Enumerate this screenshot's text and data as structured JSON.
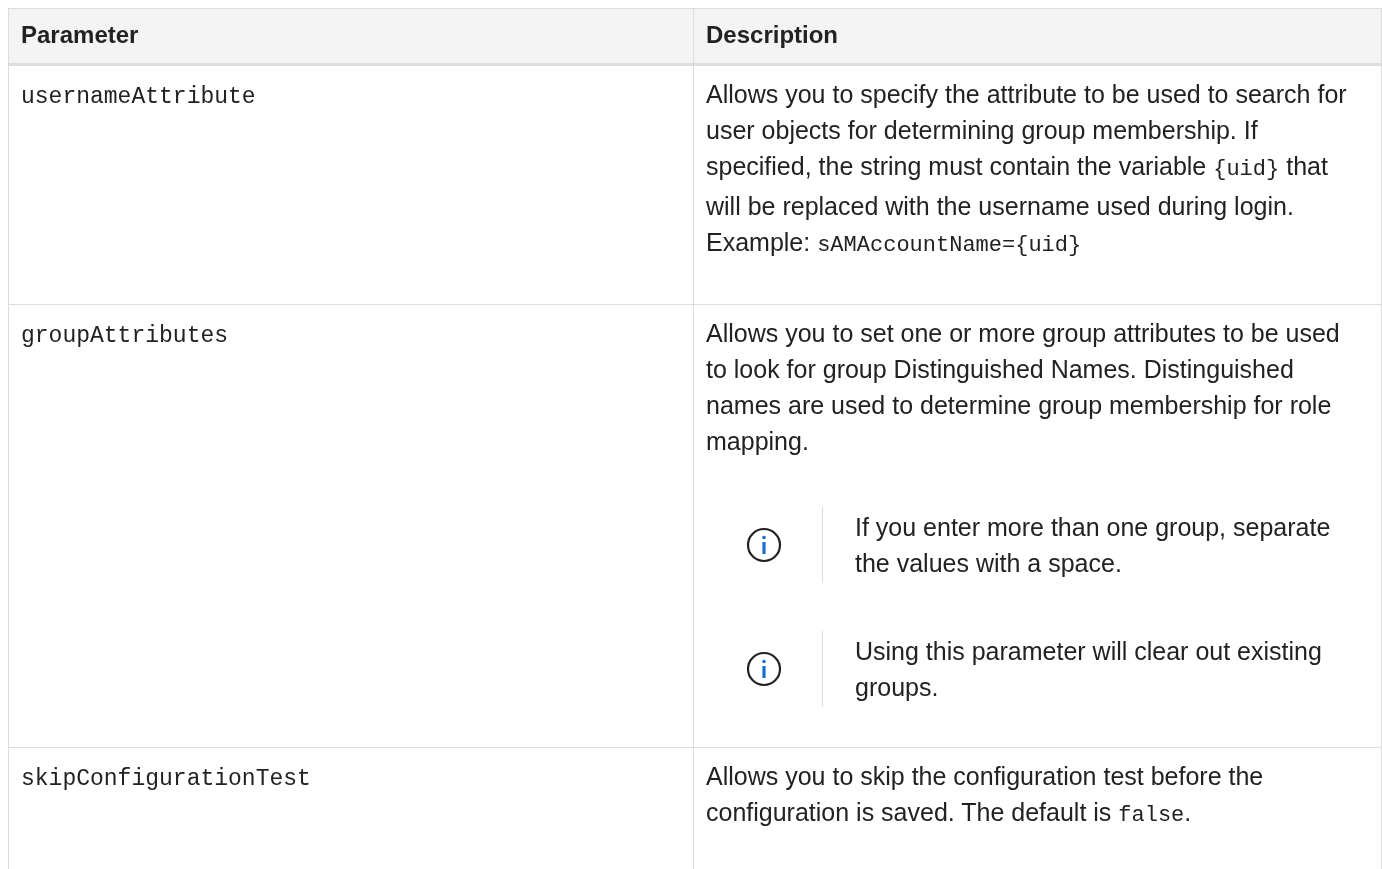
{
  "table": {
    "columns": [
      "Parameter",
      "Description"
    ],
    "rows": [
      {
        "parameter": "usernameAttribute",
        "description": [
          {
            "text": "Allows you to specify the attribute to be used to search for user objects for determining group membership. If specified, the string must contain the variable ",
            "code": false
          },
          {
            "text": "{uid}",
            "code": true
          },
          {
            "text": " that will be replaced with the username used during login. Example: ",
            "code": false
          },
          {
            "text": "sAMAccountName={uid}",
            "code": true
          }
        ],
        "notes": []
      },
      {
        "parameter": "groupAttributes",
        "description": [
          {
            "text": "Allows you to set one or more group attributes to be used to look for group Distinguished Names. Distinguished names are used to determine group membership for role mapping.",
            "code": false
          }
        ],
        "notes": [
          {
            "kind": "info",
            "text": "If you enter more than one group, separate the values with a space."
          },
          {
            "kind": "info",
            "text": "Using this parameter will clear out existing groups."
          }
        ]
      },
      {
        "parameter": "skipConfigurationTest",
        "description": [
          {
            "text": "Allows you to skip the configuration test before the configuration is saved. The default is ",
            "code": false
          },
          {
            "text": "false",
            "code": true
          },
          {
            "text": ".",
            "code": false
          }
        ],
        "notes": []
      }
    ]
  }
}
